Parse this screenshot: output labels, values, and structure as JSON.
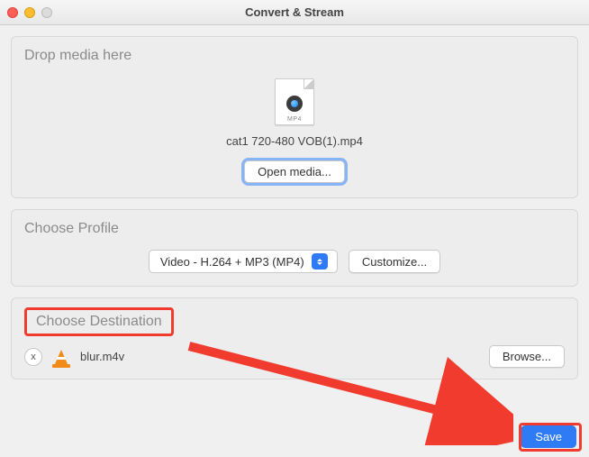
{
  "window": {
    "title": "Convert & Stream"
  },
  "drop": {
    "title": "Drop media here",
    "file_type": "MP4",
    "file_name": "cat1 720-480 VOB(1).mp4",
    "open_btn": "Open media..."
  },
  "profile": {
    "title": "Choose Profile",
    "selected": "Video - H.264 + MP3 (MP4)",
    "customize_btn": "Customize..."
  },
  "destination": {
    "title": "Choose Destination",
    "remove_label": "x",
    "file": "blur.m4v",
    "browse_btn": "Browse..."
  },
  "footer": {
    "save_btn": "Save"
  },
  "annotations": {
    "highlight_color": "#f13b2e"
  }
}
